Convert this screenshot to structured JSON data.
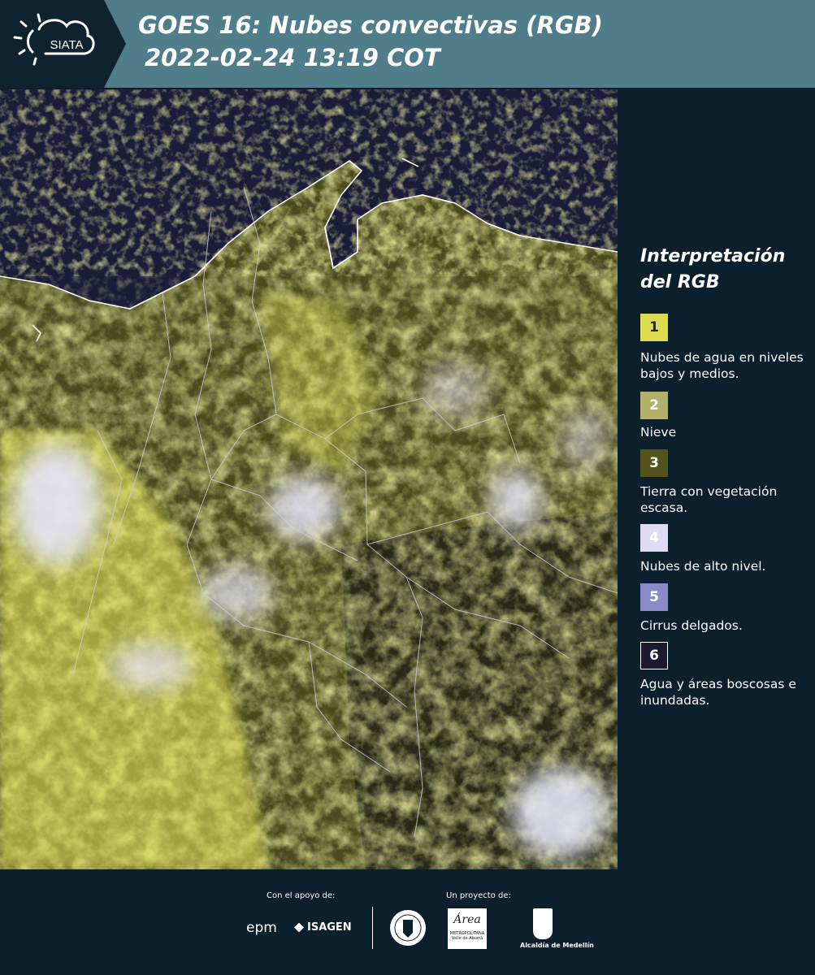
{
  "header": {
    "logo_text": "SIATA",
    "title_line1": "GOES 16: Nubes convectivas (RGB)",
    "title_line2": "2022-02-24 13:19 COT"
  },
  "legend": {
    "title_line1": "Interpretación",
    "title_line2": "del RGB",
    "items": [
      {
        "num": "1",
        "color": "#dcdc50",
        "text_color": "#2a2a10",
        "label": "Nubes de agua en niveles bajos y medios."
      },
      {
        "num": "2",
        "color": "#b2b06a",
        "text_color": "#ffffff",
        "label": "Nieve"
      },
      {
        "num": "3",
        "color": "#54531b",
        "text_color": "#ffffff",
        "label": "Tierra con vegetación escasa."
      },
      {
        "num": "4",
        "color": "#dcdcf4",
        "text_color": "#ffffff",
        "label": "Nubes de alto nivel."
      },
      {
        "num": "5",
        "color": "#8a8ac8",
        "text_color": "#ffffff",
        "label": "Cirrus delgados."
      },
      {
        "num": "6",
        "color": "#1a1a30",
        "text_color": "#ffffff",
        "label": "Agua y áreas boscosas e inundadas."
      }
    ]
  },
  "footer": {
    "support_label": "Con el apoyo de:",
    "project_label": "Un proyecto de:",
    "epm": "epm",
    "isagen": "ISAGEN",
    "area_name": "Área",
    "area_sub1": "METROPOLITANA",
    "area_sub2": "Valle de Aburrá",
    "alcaldia": "Alcaldía de Medellín"
  },
  "colors": {
    "header_bg": "#4f7d8a",
    "logo_bg": "#0e2230",
    "page_bg": "#0b1f2d",
    "cloud_yellow": "#e6e65a",
    "land_olive": "#5a5a22",
    "sea_dark": "#1b1c38",
    "high_cloud": "#dcdcf4"
  }
}
